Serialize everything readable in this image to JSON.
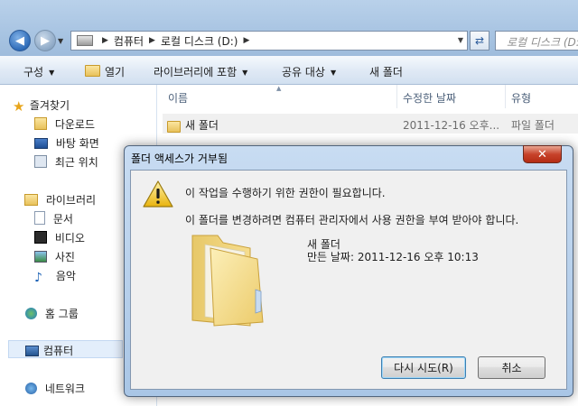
{
  "address": {
    "path": [
      "컴퓨터",
      "로컬 디스크 (D:)"
    ],
    "search_placeholder": "로컬 디스크 (D:"
  },
  "toolbar": {
    "organize": "구성",
    "open": "열기",
    "include_library": "라이브러리에 포함",
    "share": "공유 대상",
    "new_folder": "새 폴더"
  },
  "nav": {
    "favorites": "즐겨찾기",
    "downloads": "다운로드",
    "desktop": "바탕 화면",
    "recent": "최근 위치",
    "libraries": "라이브러리",
    "documents": "문서",
    "videos": "비디오",
    "pictures": "사진",
    "music": "음악",
    "homegroup": "홈 그룹",
    "computer": "컴퓨터",
    "network": "네트워크"
  },
  "files": {
    "columns": {
      "name": "이름",
      "modified": "수정한 날짜",
      "type": "유형"
    },
    "rows": [
      {
        "name": "새 폴더",
        "modified": "2011-12-16 오후...",
        "type": "파일 폴더"
      }
    ]
  },
  "dialog": {
    "title": "폴더 액세스가 거부됨",
    "heading": "이 작업을 수행하기 위한 권한이 필요합니다.",
    "message": "이 폴더를 변경하려면 컴퓨터 관리자에서 사용 권한을 부여 받아야 합니다.",
    "item_name": "새 폴더",
    "item_date": "만든 날짜: 2011-12-16 오후 10:13",
    "retry": "다시 시도(R)",
    "cancel": "취소"
  }
}
